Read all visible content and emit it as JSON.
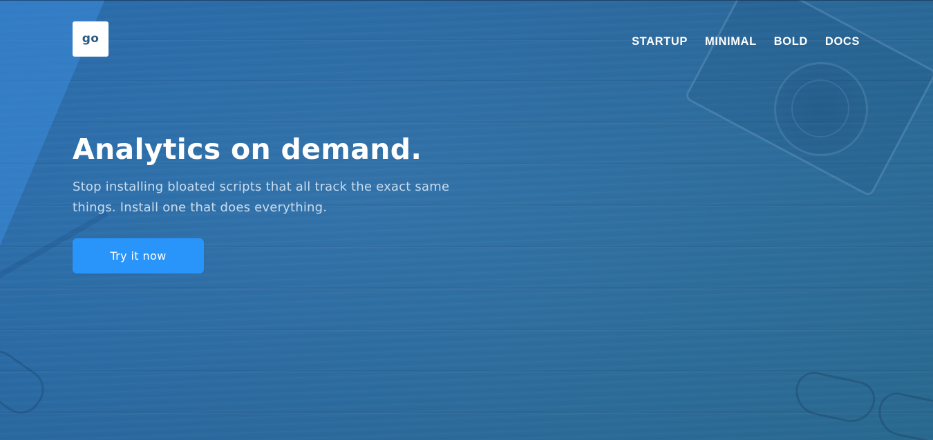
{
  "logo": {
    "text": "go"
  },
  "nav": {
    "items": [
      {
        "label": "STARTUP"
      },
      {
        "label": "MINIMAL"
      },
      {
        "label": "BOLD"
      },
      {
        "label": "DOCS"
      }
    ]
  },
  "hero": {
    "headline": "Analytics on demand.",
    "subtitle": "Stop installing bloated scripts that all track the exact same things. Install one that does everything.",
    "cta_label": "Try it now"
  },
  "colors": {
    "background": "#2d6fa6",
    "accent": "#2995fb",
    "text": "#ffffff",
    "logo_text": "#2b5b86"
  }
}
